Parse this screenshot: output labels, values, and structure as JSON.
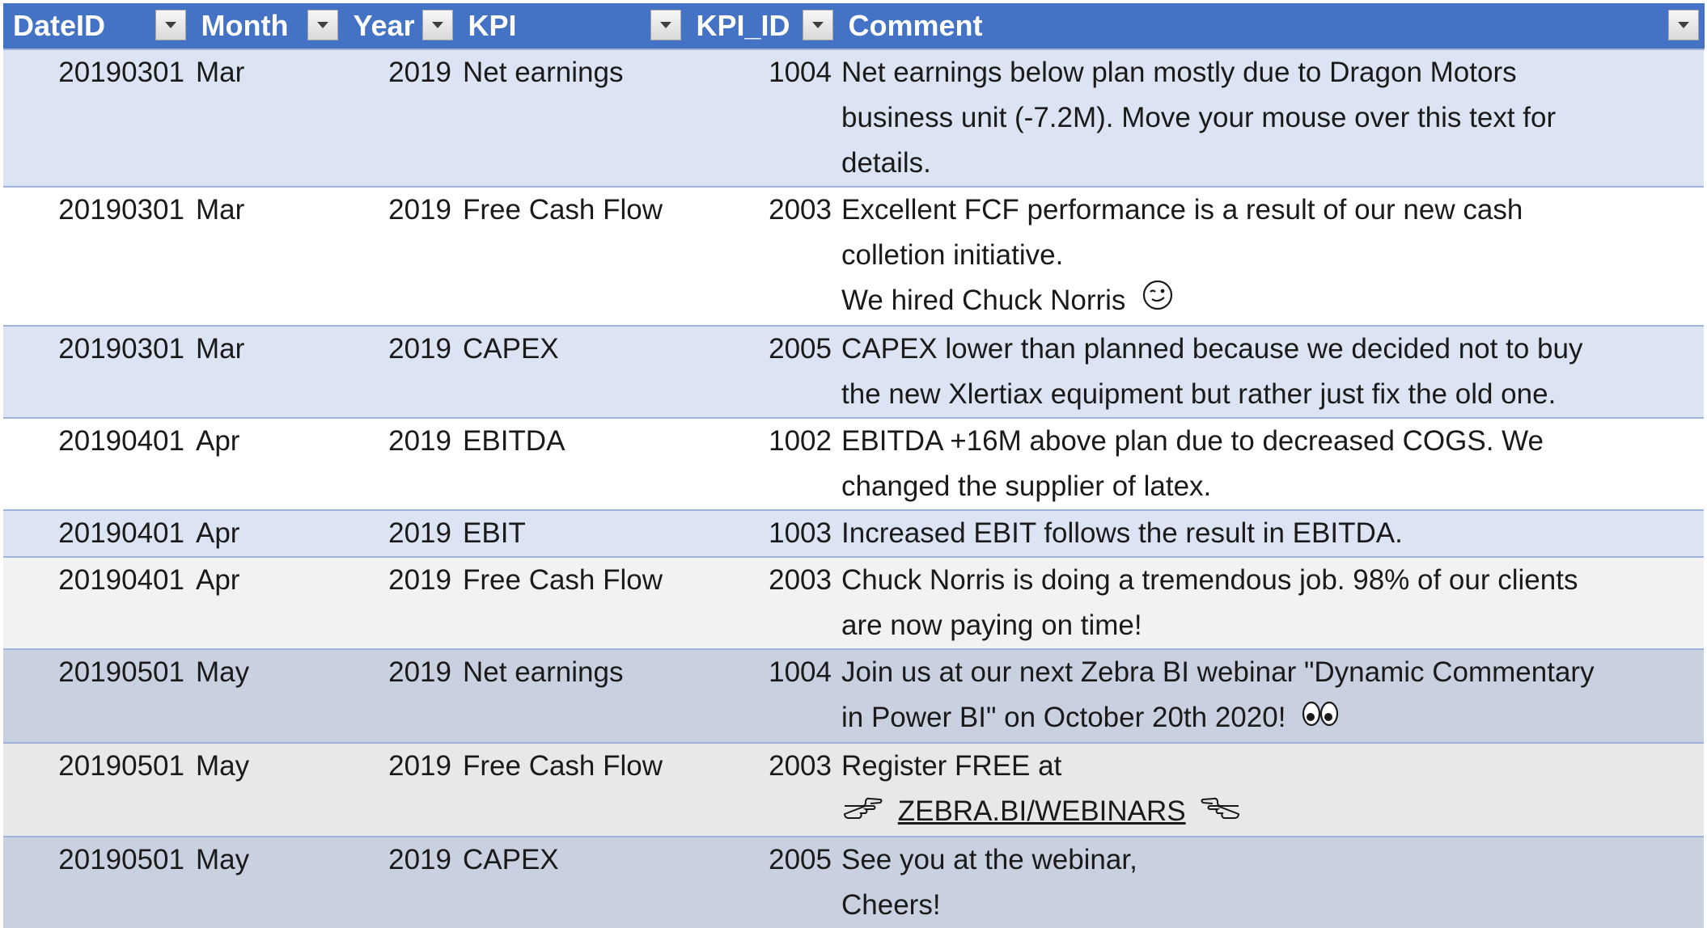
{
  "headers": [
    {
      "label": "DateID"
    },
    {
      "label": "Month"
    },
    {
      "label": "Year"
    },
    {
      "label": "KPI"
    },
    {
      "label": "KPI_ID"
    },
    {
      "label": "Comment"
    }
  ],
  "rows": [
    {
      "date_id": "20190301",
      "month": "Mar",
      "year": "2019",
      "kpi": "Net earnings",
      "kpi_id": "1004",
      "comment_lines": [
        "Net earnings below plan mostly due to Dragon Motors",
        "business unit (-7.2M). Move your mouse over this text for",
        "details."
      ]
    },
    {
      "date_id": "20190301",
      "month": "Mar",
      "year": "2019",
      "kpi": "Free Cash Flow",
      "kpi_id": "2003",
      "comment_lines": [
        "Excellent FCF performance is a result of our new cash",
        "colletion initiative.",
        "We hired Chuck Norris"
      ],
      "emoji": "winking-face-icon"
    },
    {
      "date_id": "20190301",
      "month": "Mar",
      "year": "2019",
      "kpi": "CAPEX",
      "kpi_id": "2005",
      "comment_lines": [
        "CAPEX lower than planned because we decided not to buy",
        "the new Xlertiax equipment but rather just fix the old one."
      ]
    },
    {
      "date_id": "20190401",
      "month": "Apr",
      "year": "2019",
      "kpi": "EBITDA",
      "kpi_id": "1002",
      "comment_lines": [
        "EBITDA +16M above plan due to decreased COGS. We",
        "changed the supplier of latex."
      ]
    },
    {
      "date_id": "20190401",
      "month": "Apr",
      "year": "2019",
      "kpi": "EBIT",
      "kpi_id": "1003",
      "comment_lines": [
        "Increased EBIT follows the result in EBITDA."
      ]
    },
    {
      "date_id": "20190401",
      "month": "Apr",
      "year": "2019",
      "kpi": "Free Cash Flow",
      "kpi_id": "2003",
      "comment_lines": [
        "Chuck Norris is doing a tremendous  job. 98% of our clients",
        "are now paying on time!"
      ]
    },
    {
      "date_id": "20190501",
      "month": "May",
      "year": "2019",
      "kpi": "Net earnings",
      "kpi_id": "1004",
      "comment_lines": [
        "Join us at our next Zebra BI webinar \"Dynamic Commentary",
        "in Power BI\" on October 20th 2020!"
      ],
      "emoji": "eyes-icon"
    },
    {
      "date_id": "20190501",
      "month": "May",
      "year": "2019",
      "kpi": "Free Cash Flow",
      "kpi_id": "2003",
      "comment_lines": [
        "Register FREE at"
      ],
      "link_text": "ZEBRA.BI/WEBINARS"
    },
    {
      "date_id": "20190501",
      "month": "May",
      "year": "2019",
      "kpi": "CAPEX",
      "kpi_id": "2005",
      "comment_lines": [
        "See you at the webinar,",
        "Cheers!"
      ]
    }
  ],
  "colors": {
    "header_bg": "#4472c4",
    "band": "#dce3f2"
  }
}
